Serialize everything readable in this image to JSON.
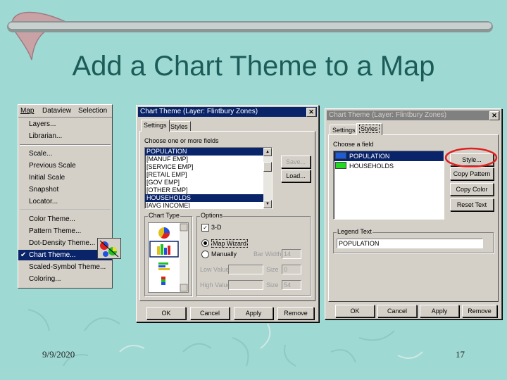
{
  "slide": {
    "title": "Add a Chart Theme to a Map",
    "date": "9/9/2020",
    "page_number": "17"
  },
  "menu": {
    "menubar": [
      "Map",
      "Dataview",
      "Selection"
    ],
    "items": [
      {
        "label": "Layers..."
      },
      {
        "label": "Librarian..."
      },
      {
        "label": "Scale..."
      },
      {
        "label": "Previous Scale"
      },
      {
        "label": "Initial Scale"
      },
      {
        "label": "Snapshot"
      },
      {
        "label": "Locator..."
      },
      {
        "label": "Color Theme..."
      },
      {
        "label": "Pattern Theme..."
      },
      {
        "label": "Dot-Density Theme..."
      },
      {
        "label": "Chart Theme...",
        "selected": true,
        "checked": true
      },
      {
        "label": "Scaled-Symbol Theme..."
      },
      {
        "label": "Coloring..."
      }
    ]
  },
  "dialog1": {
    "title": "Chart Theme (Layer: Flintbury Zones)",
    "tabs": [
      "Settings",
      "Styles"
    ],
    "fields_label": "Choose one or more fields",
    "fields": [
      {
        "label": "POPULATION",
        "selected": true
      },
      {
        "label": "[MANUF EMP]",
        "selected": false
      },
      {
        "label": "[SERVICE EMP]",
        "selected": false
      },
      {
        "label": "[RETAIL EMP]",
        "selected": false
      },
      {
        "label": "[GOV EMP]",
        "selected": false
      },
      {
        "label": "[OTHER EMP]",
        "selected": false
      },
      {
        "label": "HOUSEHOLDS",
        "selected": true
      },
      {
        "label": "[AVG INCOME]",
        "selected": false
      }
    ],
    "save_label": "Save...",
    "load_label": "Load...",
    "chart_type_label": "Chart Type",
    "options_label": "Options",
    "three_d_label": "3-D",
    "three_d_mark": "✓",
    "map_wizard_label": "Map Wizard",
    "manually_label": "Manually",
    "bar_width_label": "Bar Width",
    "bar_width_value": "14",
    "low_value_label": "Low Value",
    "high_value_label": "High Value",
    "size_label": "Size",
    "low_size_value": "0",
    "high_size_value": "54",
    "ok_label": "OK",
    "cancel_label": "Cancel",
    "apply_label": "Apply",
    "remove_label": "Remove"
  },
  "dialog2": {
    "title": "Chart Theme (Layer: Flintbury Zones)",
    "tabs": [
      "Settings",
      "Styles"
    ],
    "field_label": "Choose a field",
    "fields": [
      {
        "label": "POPULATION",
        "color": "#1e5bd8",
        "selected": true
      },
      {
        "label": "HOUSEHOLDS",
        "color": "#22d822",
        "selected": false
      }
    ],
    "style_label": "Style...",
    "copy_pattern_label": "Copy Pattern",
    "copy_color_label": "Copy Color",
    "reset_text_label": "Reset Text",
    "legend_text_label": "Legend Text",
    "legend_text_value": "POPULATION",
    "ok_label": "OK",
    "cancel_label": "Cancel",
    "apply_label": "Apply",
    "remove_label": "Remove"
  },
  "colors": {
    "background": "#9fd9d3",
    "title": "#1b5b58",
    "selection": "#0a246a",
    "highlight_circle": "#e02020"
  }
}
